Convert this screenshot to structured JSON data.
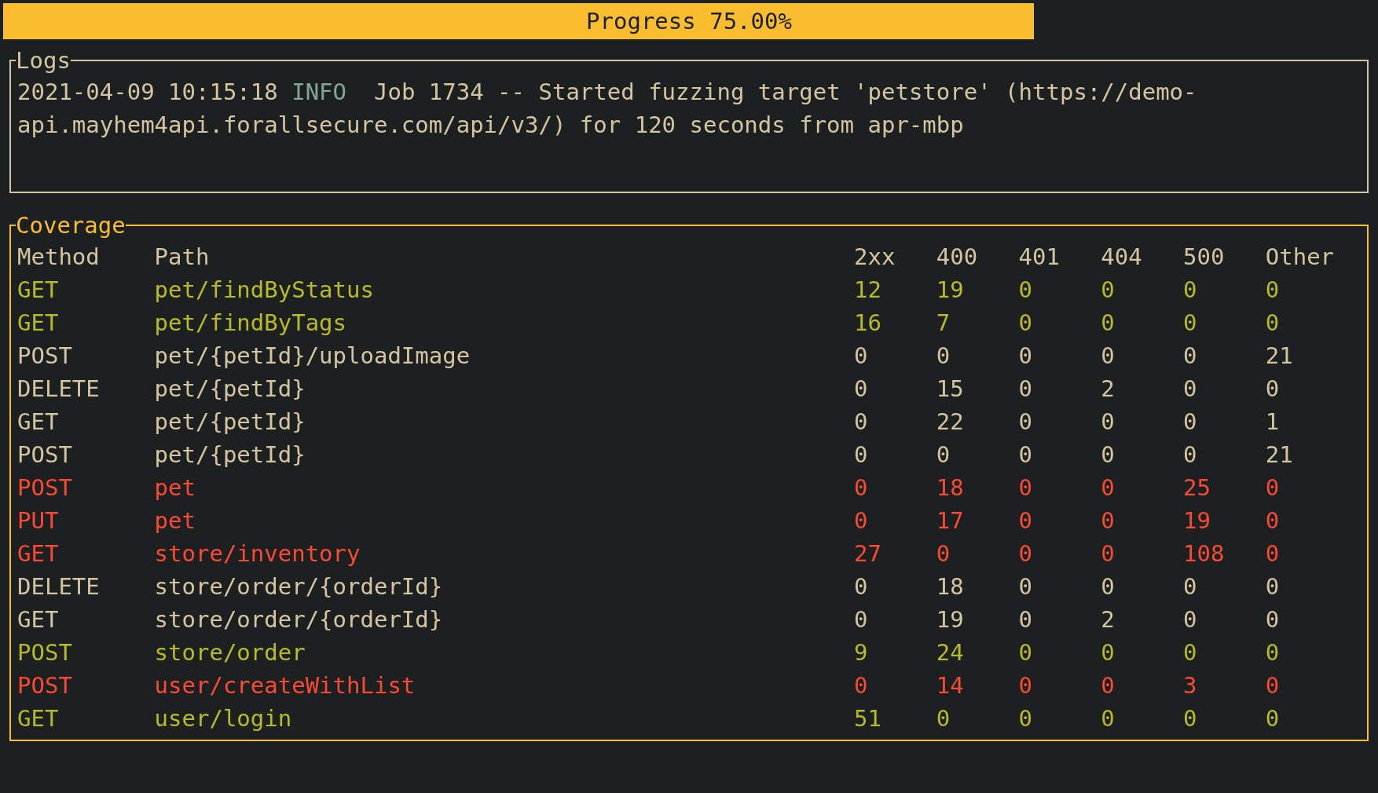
{
  "progress": {
    "label": "Progress 75.00%",
    "level": 0.75
  },
  "logs": {
    "title": "Logs",
    "entries": [
      {
        "timestamp": "2021-04-09 10:15:18",
        "level": "INFO",
        "message": "Job 1734 -- Started fuzzing target 'petstore' (https://demo-api.mayhem4api.forallsecure.com/api/v3/) for 120 seconds from apr-mbp"
      }
    ]
  },
  "coverage": {
    "title": "Coverage",
    "columns": [
      "Method",
      "Path",
      "2xx",
      "400",
      "401",
      "404",
      "500",
      "Other"
    ],
    "rows": [
      {
        "color": "#b8bb26",
        "cells": [
          "GET",
          "pet/findByStatus",
          "12",
          "19",
          "0",
          "0",
          "0",
          "0"
        ]
      },
      {
        "color": "#b8bb26",
        "cells": [
          "GET",
          "pet/findByTags",
          "16",
          "7",
          "0",
          "0",
          "0",
          "0"
        ]
      },
      {
        "color": "#d5c4a1",
        "cells": [
          "POST",
          "pet/{petId}/uploadImage",
          "0",
          "0",
          "0",
          "0",
          "0",
          "21"
        ]
      },
      {
        "color": "#d5c4a1",
        "cells": [
          "DELETE",
          "pet/{petId}",
          "0",
          "15",
          "0",
          "2",
          "0",
          "0"
        ]
      },
      {
        "color": "#d5c4a1",
        "cells": [
          "GET",
          "pet/{petId}",
          "0",
          "22",
          "0",
          "0",
          "0",
          "1"
        ]
      },
      {
        "color": "#d5c4a1",
        "cells": [
          "POST",
          "pet/{petId}",
          "0",
          "0",
          "0",
          "0",
          "0",
          "21"
        ]
      },
      {
        "color": "#fb4934",
        "cells": [
          "POST",
          "pet",
          "0",
          "18",
          "0",
          "0",
          "25",
          "0"
        ]
      },
      {
        "color": "#fb4934",
        "cells": [
          "PUT",
          "pet",
          "0",
          "17",
          "0",
          "0",
          "19",
          "0"
        ]
      },
      {
        "color": "#fb4934",
        "cells": [
          "GET",
          "store/inventory",
          "27",
          "0",
          "0",
          "0",
          "108",
          "0"
        ]
      },
      {
        "color": "#d5c4a1",
        "cells": [
          "DELETE",
          "store/order/{orderId}",
          "0",
          "18",
          "0",
          "0",
          "0",
          "0"
        ]
      },
      {
        "color": "#d5c4a1",
        "cells": [
          "GET",
          "store/order/{orderId}",
          "0",
          "19",
          "0",
          "2",
          "0",
          "0"
        ]
      },
      {
        "color": "#b8bb26",
        "cells": [
          "POST",
          "store/order",
          "9",
          "24",
          "0",
          "0",
          "0",
          "0"
        ]
      },
      {
        "color": "#fb4934",
        "cells": [
          "POST",
          "user/createWithList",
          "0",
          "14",
          "0",
          "0",
          "3",
          "0"
        ]
      },
      {
        "color": "#b8bb26",
        "cells": [
          "GET",
          "user/login",
          "51",
          "0",
          "0",
          "0",
          "0",
          "0"
        ]
      }
    ]
  }
}
